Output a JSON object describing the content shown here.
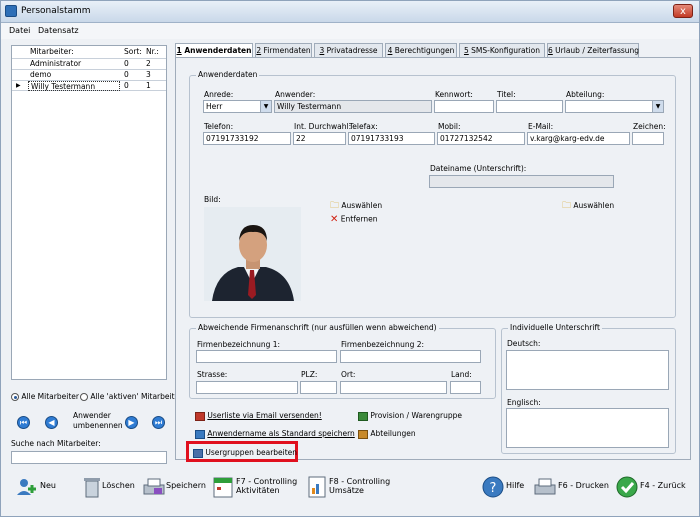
{
  "window": {
    "title": "Personalstamm",
    "close": "x"
  },
  "menu": {
    "file": "Datei",
    "record": "Datensatz"
  },
  "grid": {
    "headers": [
      "Mitarbeiter:",
      "Sort:",
      "Nr.:"
    ],
    "rows": [
      {
        "marker": "",
        "name": "Administrator",
        "sort": "0",
        "nr": "2"
      },
      {
        "marker": "",
        "name": "demo",
        "sort": "0",
        "nr": "3"
      },
      {
        "marker": "▶",
        "name": "Willy Testermann",
        "sort": "0",
        "nr": "1"
      }
    ]
  },
  "left": {
    "radio_all": "Alle Mitarbeiter",
    "radio_active": "Alle 'aktiven' Mitarbeiter",
    "rename_label_1": "Anwender",
    "rename_label_2": "umbenennen",
    "search_label": "Suche nach Mitarbeiter:",
    "search_value": ""
  },
  "tabs": [
    {
      "num": "1",
      "label": " Anwenderdaten"
    },
    {
      "num": "2",
      "label": " Firmendaten"
    },
    {
      "num": "3",
      "label": " Privatadresse"
    },
    {
      "num": "4",
      "label": " Berechtigungen"
    },
    {
      "num": "5",
      "label": " SMS-Konfiguration"
    },
    {
      "num": "6",
      "label": " Urlaub / Zeiterfassung"
    }
  ],
  "user": {
    "group_title": "Anwenderdaten",
    "anrede_label": "Anrede:",
    "anrede_value": "Herr",
    "anwender_label": "Anwender:",
    "anwender_value": "Willy Testermann",
    "kennwort_label": "Kennwort:",
    "kennwort_value": "",
    "titel_label": "Titel:",
    "titel_value": "",
    "abteilung_label": "Abteilung:",
    "abteilung_value": "",
    "telefon_label": "Telefon:",
    "telefon_value": "07191733192",
    "durchwahl_label": "Int. Durchwahl:",
    "durchwahl_value": "22",
    "telefax_label": "Telefax:",
    "telefax_value": "07191733193",
    "mobil_label": "Mobil:",
    "mobil_value": "01727132542",
    "email_label": "E-Mail:",
    "email_value": "v.karg@karg-edv.de",
    "zeichen_label": "Zeichen:",
    "zeichen_value": "",
    "signature_file_label": "Dateiname (Unterschrift):",
    "signature_file_value": "",
    "bild_label": "Bild:",
    "select_label": "Auswählen",
    "remove_label": "Entfernen",
    "select2_label": "Auswählen"
  },
  "address": {
    "group_title": "Abweichende Firmenanschrift (nur ausfüllen wenn abweichend)",
    "firma1_label": "Firmenbezeichnung 1:",
    "firma1_value": "",
    "firma2_label": "Firmenbezeichnung 2:",
    "firma2_value": "",
    "strasse_label": "Strasse:",
    "strasse_value": "",
    "plz_label": "PLZ:",
    "plz_value": "",
    "ort_label": "Ort:",
    "ort_value": "",
    "land_label": "Land:",
    "land_value": ""
  },
  "signature": {
    "group_title": "Individuelle Unterschrift",
    "deutsch_label": "Deutsch:",
    "deutsch_value": "",
    "englisch_label": "Englisch:",
    "englisch_value": ""
  },
  "actions": {
    "email_list": "Userliste via Email versenden!",
    "commission": "Provision / Warengruppe",
    "save_default": "Anwendername als Standard speichern",
    "departments": "Abteilungen",
    "edit_groups": "Usergruppen bearbeiten"
  },
  "toolbar": {
    "new": "Neu",
    "delete": "Löschen",
    "save": "Speichern",
    "f7_line1": "F7 - Controlling",
    "f7_line2": "Aktivitäten",
    "f8_line1": "F8 - Controlling",
    "f8_line2": "Umsätze",
    "help": "Hilfe",
    "print": "F6 - Drucken",
    "back": "F4 - Zurück"
  },
  "colors": {
    "highlight_border": "#e0101e",
    "nav_blue": "#2f7cd3"
  }
}
